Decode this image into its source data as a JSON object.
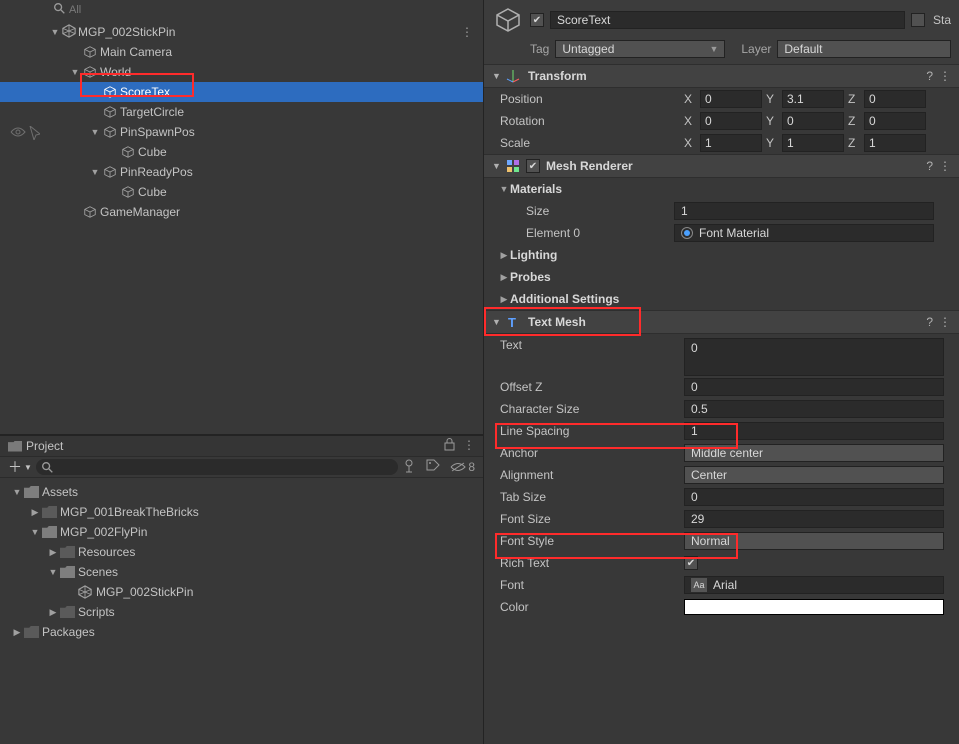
{
  "hierarchy": {
    "search_placeholder": "All",
    "scene": "MGP_002StickPin",
    "items": [
      "Main Camera",
      "World",
      "ScoreTex",
      "TargetCircle",
      "PinSpawnPos",
      "Cube",
      "PinReadyPos",
      "Cube",
      "GameManager"
    ]
  },
  "project": {
    "title": "Project",
    "toolbar_hidden_count": "8",
    "assets": "Assets",
    "items": [
      "MGP_001BreakTheBricks",
      "MGP_002FlyPin",
      "Resources",
      "Scenes",
      "MGP_002StickPin",
      "Scripts"
    ],
    "packages": "Packages"
  },
  "inspector": {
    "name": "ScoreText",
    "static_label": "Sta",
    "tag_label": "Tag",
    "tag_value": "Untagged",
    "layer_label": "Layer",
    "layer_value": "Default",
    "transform": {
      "title": "Transform",
      "position_label": "Position",
      "rotation_label": "Rotation",
      "scale_label": "Scale",
      "pos": {
        "x": "0",
        "y": "3.1",
        "z": "0"
      },
      "rot": {
        "x": "0",
        "y": "0",
        "z": "0"
      },
      "scl": {
        "x": "1",
        "y": "1",
        "z": "1"
      }
    },
    "mesh_renderer": {
      "title": "Mesh Renderer",
      "materials": "Materials",
      "size_label": "Size",
      "size_value": "1",
      "element0_label": "Element 0",
      "element0_value": "Font Material",
      "lighting": "Lighting",
      "probes": "Probes",
      "additional": "Additional Settings"
    },
    "text_mesh": {
      "title": "Text Mesh",
      "text_label": "Text",
      "text_value": "0",
      "offsetz_label": "Offset Z",
      "offsetz_value": "0",
      "char_size_label": "Character Size",
      "char_size_value": "0.5",
      "line_spacing_label": "Line Spacing",
      "line_spacing_value": "1",
      "anchor_label": "Anchor",
      "anchor_value": "Middle center",
      "alignment_label": "Alignment",
      "alignment_value": "Center",
      "tab_size_label": "Tab Size",
      "tab_size_value": "0",
      "font_size_label": "Font Size",
      "font_size_value": "29",
      "font_style_label": "Font Style",
      "font_style_value": "Normal",
      "rich_text_label": "Rich Text",
      "font_label": "Font",
      "font_value": "Arial",
      "color_label": "Color"
    }
  }
}
